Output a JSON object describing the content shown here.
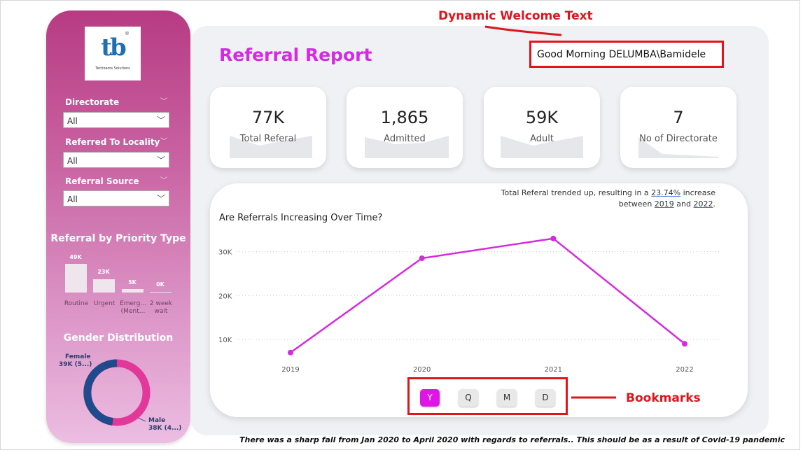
{
  "logo": {
    "name": "Techbams Solutions",
    "reg": "®"
  },
  "slicers": [
    {
      "label": "Directorate",
      "value": "All"
    },
    {
      "label": "Referred To Locality",
      "value": "All"
    },
    {
      "label": "Referral Source",
      "value": "All"
    }
  ],
  "priority": {
    "title": "Referral by Priority Type",
    "bars": [
      {
        "category": "Routine",
        "label": "49K",
        "value": 49000
      },
      {
        "category": "Urgent",
        "label": "23K",
        "value": 23000
      },
      {
        "category": "Emerg... (Ment...",
        "label": "5K",
        "value": 5000
      },
      {
        "category": "2 week wait",
        "label": "0K",
        "value": 0
      }
    ]
  },
  "gender": {
    "title": "Gender Distribution",
    "female": {
      "label": "Female",
      "value": "39K (5...)",
      "color": "#1f4a8b"
    },
    "male": {
      "label": "Male",
      "value": "38K (4...)",
      "color": "#e1389a"
    }
  },
  "header": {
    "title": "Referral Report",
    "welcome": "Good Morning DELUMBA\\Bamidele"
  },
  "annotations": {
    "welcome": "Dynamic Welcome Text",
    "bookmarks": "Bookmarks"
  },
  "kpis": [
    {
      "value": "77K",
      "label": "Total Referal"
    },
    {
      "value": "1,865",
      "label": "Admitted"
    },
    {
      "value": "59K",
      "label": "Adult"
    },
    {
      "value": "7",
      "label": "No of Directorate"
    }
  ],
  "insight": {
    "part1": "Total Referal trended up, resulting in a ",
    "pct": "23.74%",
    "part2": " increase",
    "part3": "between ",
    "y1": "2019",
    "and": " and ",
    "y2": "2022",
    "end": "."
  },
  "chart_data": {
    "type": "line",
    "title": "Are Referrals Increasing Over Time?",
    "categories": [
      "2019",
      "2020",
      "2021",
      "2022"
    ],
    "series": [
      {
        "values": [
          7000,
          28500,
          33000,
          9000
        ]
      }
    ],
    "yticks": [
      10000,
      20000,
      30000
    ],
    "ytick_labels": [
      "10K",
      "20K",
      "30K"
    ],
    "ylim": [
      2500,
      36000
    ],
    "color": "#d52be0"
  },
  "bookmarks": [
    {
      "label": "Y",
      "active": true
    },
    {
      "label": "Q",
      "active": false
    },
    {
      "label": "M",
      "active": false
    },
    {
      "label": "D",
      "active": false
    }
  ],
  "footer": "There was a sharp fall from Jan 2020 to April 2020 with regards to referrals.. This should be as a result of Covid-19 pandemic"
}
